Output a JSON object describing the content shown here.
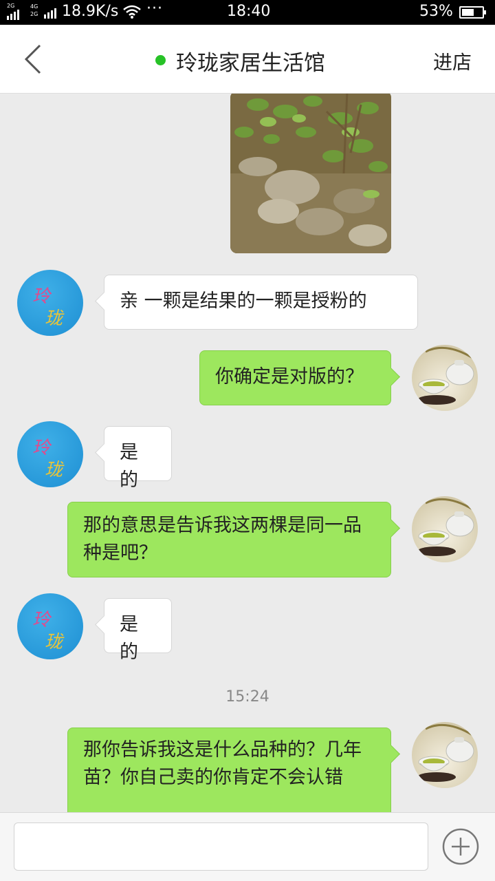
{
  "status_bar": {
    "net_top": "2G",
    "net_mid_top": "4G",
    "net_mid_bottom": "2G",
    "speed": "18.9K/s",
    "more": "···",
    "time": "18:40",
    "battery": "53%"
  },
  "header": {
    "title": "玲珑家居生活馆",
    "enter_shop": "进店",
    "online_color": "#27c227"
  },
  "shop_avatar": {
    "line1": "玲",
    "line2": "珑"
  },
  "messages": [
    {
      "side": "in",
      "text": "亲  一颗是结果的一颗是授粉的"
    },
    {
      "side": "out",
      "text": "你确定是对版的？"
    },
    {
      "side": "in",
      "text": "是的"
    },
    {
      "side": "out",
      "text": "那的意思是告诉我这两棵是同一品种是吧？"
    },
    {
      "side": "in",
      "text": "是的"
    },
    {
      "side": "out",
      "text": "那你告诉我这是什么品种的？几年苗？你自己卖的你肯定不会认错"
    }
  ],
  "timestamp": "15:24",
  "input": {
    "value": ""
  },
  "colors": {
    "out_bubble": "#9de75e",
    "in_bubble": "#ffffff",
    "background": "#ebebeb"
  }
}
